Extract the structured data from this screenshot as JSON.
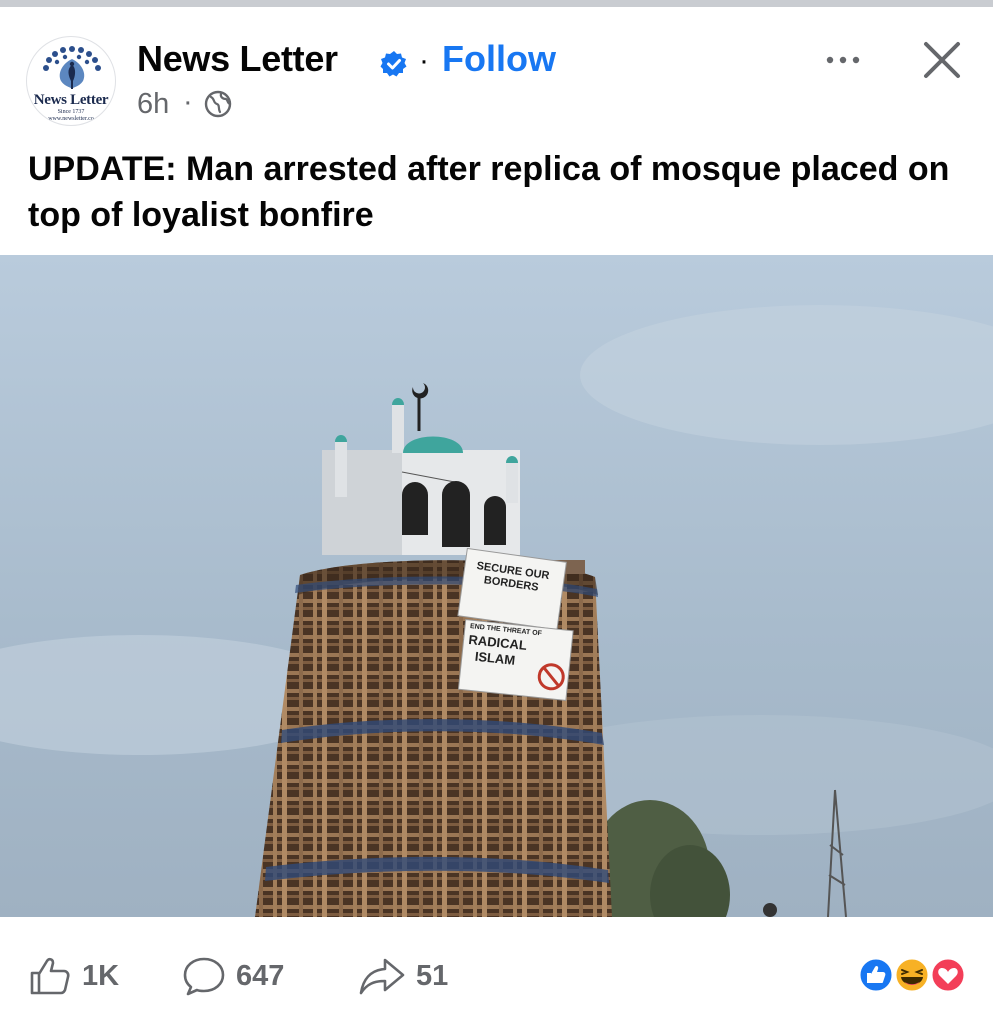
{
  "post": {
    "page_name": "News Letter",
    "follow_label": "Follow",
    "separator": "·",
    "time": "6h",
    "headline": "UPDATE: Man arrested after replica of mosque placed on top of loyalist bonfire"
  },
  "avatar": {
    "brand": "News Letter",
    "since": "Since 1737",
    "url": "www.newsletter.co"
  },
  "photo": {
    "sign_top": [
      "SECURE OUR",
      "BORDERS"
    ],
    "sign_bottom": [
      "END THE THREAT OF",
      "RADICAL",
      "ISLAM"
    ]
  },
  "actions": {
    "likes": "1K",
    "comments": "647",
    "shares": "51"
  },
  "colors": {
    "accent": "#1877f2",
    "muted": "#65676b",
    "sky": "#a9bccd"
  },
  "icons": [
    "verified-badge-icon",
    "globe-icon",
    "more-icon",
    "close-icon",
    "like-icon",
    "comment-icon",
    "share-icon",
    "like-reaction-icon",
    "haha-reaction-icon",
    "love-reaction-icon"
  ]
}
